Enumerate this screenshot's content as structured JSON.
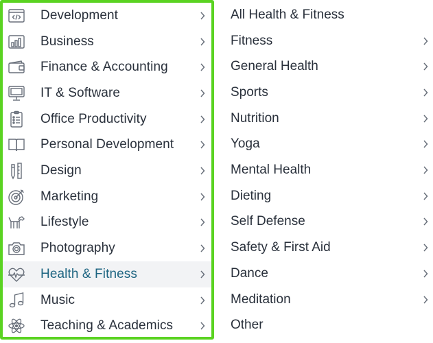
{
  "categories": [
    {
      "label": "Development",
      "icon": "code-window-icon"
    },
    {
      "label": "Business",
      "icon": "bar-chart-icon"
    },
    {
      "label": "Finance & Accounting",
      "icon": "wallet-icon"
    },
    {
      "label": "IT & Software",
      "icon": "monitor-icon"
    },
    {
      "label": "Office Productivity",
      "icon": "clipboard-list-icon"
    },
    {
      "label": "Personal Development",
      "icon": "book-icon"
    },
    {
      "label": "Design",
      "icon": "pencil-ruler-icon"
    },
    {
      "label": "Marketing",
      "icon": "target-icon"
    },
    {
      "label": "Lifestyle",
      "icon": "dog-icon"
    },
    {
      "label": "Photography",
      "icon": "camera-icon"
    },
    {
      "label": "Health & Fitness",
      "icon": "heartbeat-icon"
    },
    {
      "label": "Music",
      "icon": "music-note-icon"
    },
    {
      "label": "Teaching & Academics",
      "icon": "atom-icon"
    }
  ],
  "active_category": "Health & Fitness",
  "subcategories": [
    {
      "label": "All Health & Fitness",
      "has_arrow": false
    },
    {
      "label": "Fitness",
      "has_arrow": true
    },
    {
      "label": "General Health",
      "has_arrow": true
    },
    {
      "label": "Sports",
      "has_arrow": true
    },
    {
      "label": "Nutrition",
      "has_arrow": true
    },
    {
      "label": "Yoga",
      "has_arrow": true
    },
    {
      "label": "Mental Health",
      "has_arrow": true
    },
    {
      "label": "Dieting",
      "has_arrow": true
    },
    {
      "label": "Self Defense",
      "has_arrow": true
    },
    {
      "label": "Safety & First Aid",
      "has_arrow": true
    },
    {
      "label": "Dance",
      "has_arrow": true
    },
    {
      "label": "Meditation",
      "has_arrow": true
    },
    {
      "label": "Other",
      "has_arrow": false
    }
  ],
  "colors": {
    "highlight_border": "#5ad321",
    "active_text": "#1d6481",
    "active_bg": "#f2f3f5",
    "text": "#29303b",
    "icon": "#686f7a"
  }
}
